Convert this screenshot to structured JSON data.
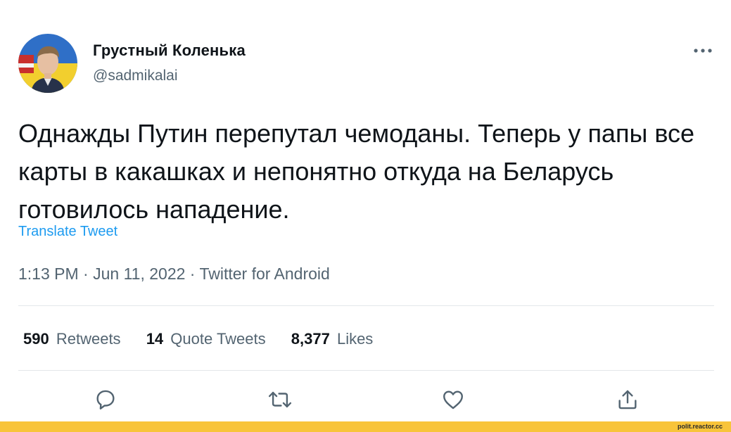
{
  "author": {
    "display_name": "Грустный Коленька",
    "handle": "@sadmikalai",
    "avatar_icon": "avatar-photo"
  },
  "tweet": {
    "text": "Однажды Путин перепутал чемоданы. Теперь у папы все карты в какашках и непонятно откуда на Беларусь готовилось нападение.",
    "translate_label": "Translate Tweet",
    "time": "1:13 PM",
    "separator": "·",
    "date": "Jun 11, 2022",
    "source": "Twitter for Android"
  },
  "stats": [
    {
      "count": "590",
      "label": "Retweets"
    },
    {
      "count": "14",
      "label": "Quote Tweets"
    },
    {
      "count": "8,377",
      "label": "Likes"
    }
  ],
  "actions": [
    {
      "name": "reply",
      "icon": "reply-icon"
    },
    {
      "name": "retweet",
      "icon": "retweet-icon"
    },
    {
      "name": "like",
      "icon": "heart-icon"
    },
    {
      "name": "share",
      "icon": "share-icon"
    }
  ],
  "colors": {
    "text": "#0f1419",
    "secondary": "#536471",
    "link": "#1d9bf0",
    "footer": "#f8c43a"
  },
  "watermark": "polit.reactor.cc"
}
